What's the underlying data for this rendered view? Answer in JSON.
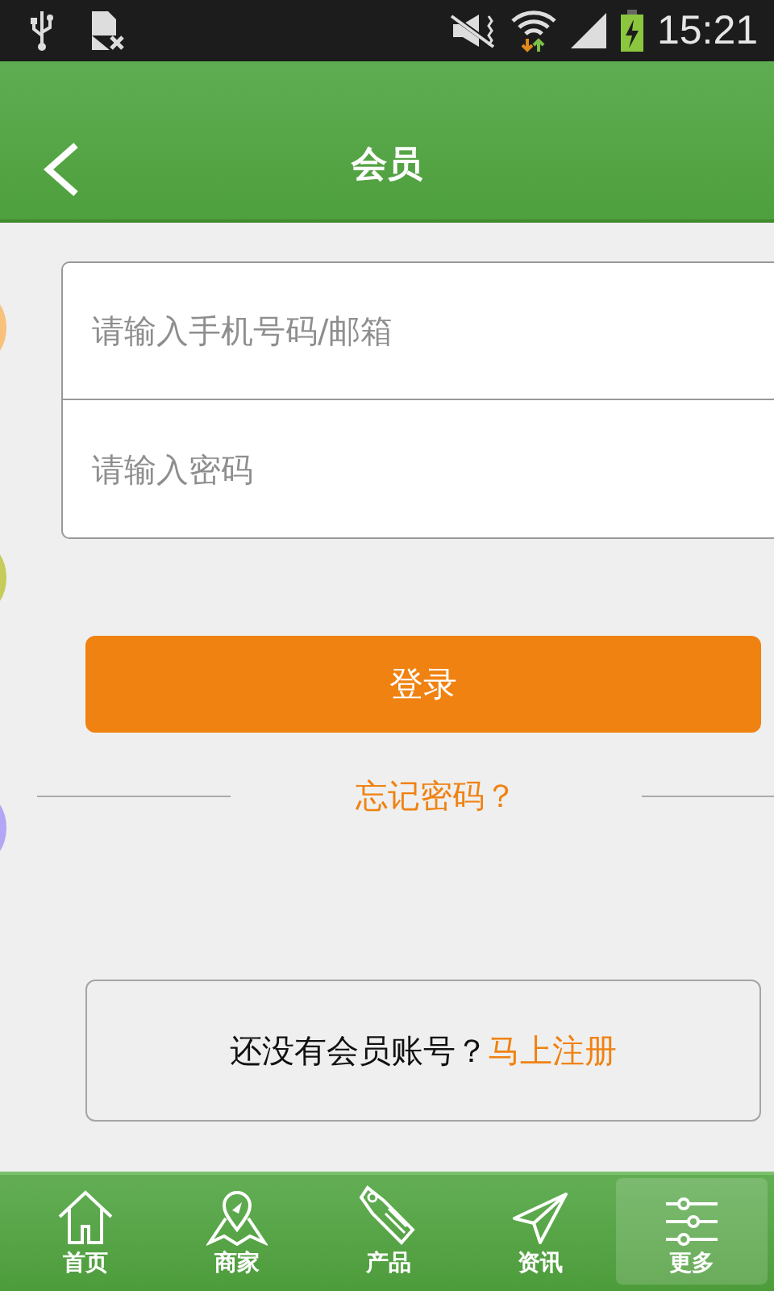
{
  "status_bar": {
    "time": "15:21"
  },
  "header": {
    "title": "会员"
  },
  "login_form": {
    "fields": [
      {
        "placeholder": "请输入手机号码/邮箱"
      },
      {
        "placeholder": "请输入密码"
      }
    ],
    "submit": "登录",
    "forgot_link": "忘记密码？"
  },
  "register": {
    "prompt": "还没有会员账号？",
    "link": "马上注册"
  },
  "tab_bar": [
    {
      "kind": "home",
      "label": "首页",
      "selected": false
    },
    {
      "kind": "map",
      "label": "商家",
      "selected": false
    },
    {
      "kind": "tag",
      "label": "产品",
      "selected": false
    },
    {
      "kind": "send",
      "label": "资讯",
      "selected": false
    },
    {
      "kind": "sliders",
      "label": "更多",
      "selected": true
    }
  ]
}
